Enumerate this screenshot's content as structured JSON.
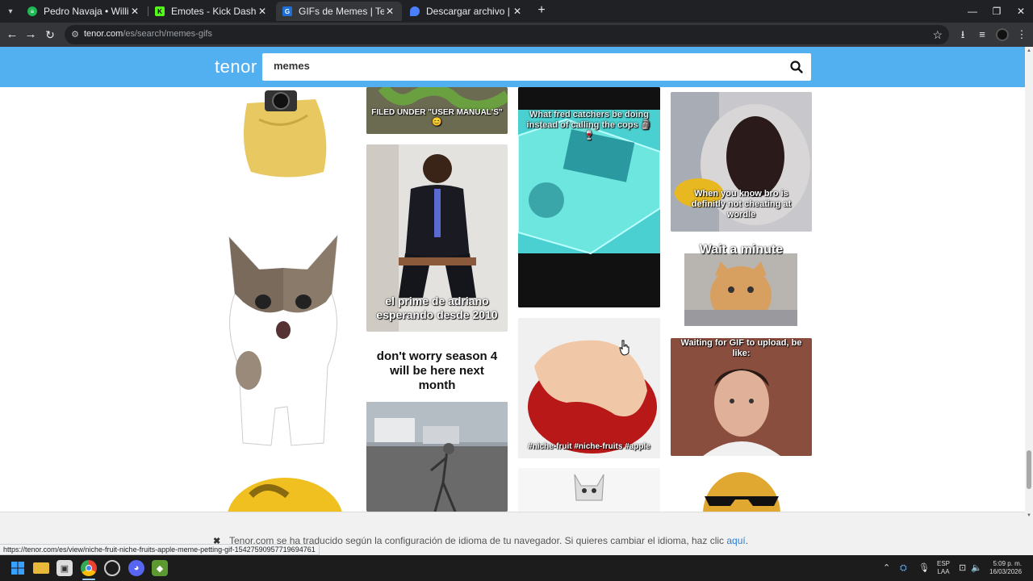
{
  "browser": {
    "tabs": [
      {
        "label": "Pedro Navaja • Willie Colón, Rubén",
        "favicon": "spotify-icon",
        "color": "#1db954"
      },
      {
        "label": "Emotes - Kick Dashboard",
        "favicon": "kick-icon",
        "color": "#53fc18"
      },
      {
        "label": "GIFs de Memes | Tenor",
        "favicon": "tenor-icon",
        "color": "#1e6fd9",
        "active": true
      },
      {
        "label": "Descargar archivo | iLoveIMG",
        "favicon": "iloveimg-icon",
        "color": "#4a7fff"
      }
    ],
    "url_domain": "tenor.com",
    "url_path": "/es/search/memes-gifs"
  },
  "page": {
    "logo": "tenor",
    "search_value": "memes",
    "gifs": {
      "col2_top": "FILED UNDER \"USER MANUAL'S\" 😊",
      "adriano": "el prime de adriano esperando desde 2010",
      "season4": "don't worry season 4 will be here next month",
      "fred": "What fred catchers be doing instead of calling the cops 🗿🍷",
      "wordle": "When you know bro is definitly not cheating at wordle",
      "wait": "Wait a minute",
      "niche": "#niche-fruit #niche-fruits #apple",
      "waiting": "Waiting for GIF to upload, be like:"
    },
    "banner": {
      "text": "Tenor.com se ha traducido según la configuración de idioma de tu navegador. Si quieres cambiar el idioma, haz clic",
      "link": "aquí",
      "end": "."
    }
  },
  "status_url": "https://tenor.com/es/view/niche-fruit-niche-fruits-apple-meme-petting-gif-15427590957719694761",
  "taskbar": {
    "lang_top": "ESP",
    "lang_bottom": "LAA",
    "time": "5:09 p. m.",
    "date": "16/03/2026"
  }
}
